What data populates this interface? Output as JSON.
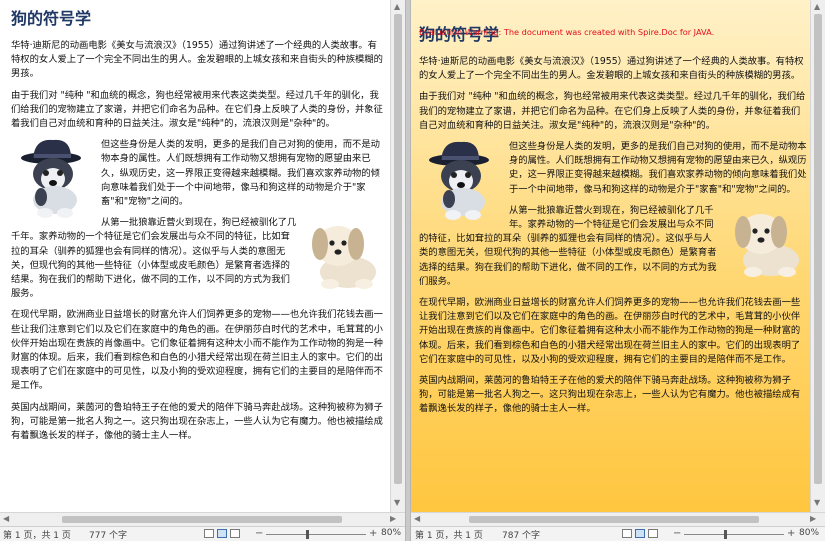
{
  "left_doc": {
    "title": "狗的符号学",
    "paragraphs": [
      "华特·迪斯尼的动画电影《美女与流浪汉》（1955）通过狗讲述了一个经典的人类故事。有特权的女人爱上了一个完全不同出生的男人。金发碧眼的上城女孩和来自街头的种族模糊的男孩。",
      "由于我们对 \"纯种 \"和血统的概念，狗也经常被用来代表这类类型。经过几千年的驯化，我们给我们的宠物建立了家谱，并把它们命名为品种。在它们身上反映了人类的身份，并象征着我们自己对血统和育种的日益关注。淑女是\"纯种\"的，流浪汉则是\"杂种\"的。",
      "但这些身份是人类的发明，更多的是我们自己对狗的使用，而不是动物本身的属性。人们既想拥有工作动物又想拥有宠物的愿望由来已久，纵观历史，这一界限正变得越来越模糊。我们喜欢家养动物的倾向意味着我们处于一个中间地带，像马和狗这样的动物是介于\"家畜\"和\"宠物\"之间的。",
      "从第一批狼靠近营火到现在，狗已经被驯化了几千年。家养动物的一个特征是它们会发展出与众不同的特征，比如耷拉的耳朵（驯养的狐狸也会有同样的情况）。这似乎与人类的意图无关，但现代狗的其他一些特征（小体型或皮毛颜色）是繁育者选择的结果。狗在我们的帮助下进化，做不同的工作，以不同的方式为我们服务。",
      "在现代早期，欧洲商业日益增长的财富允许人们饲养更多的宠物——也允许我们花钱去画一些让我们注意到它们以及它们在家庭中的角色的画。在伊丽莎白时代的艺术中，毛茸茸的小伙伴开始出现在贵族的肖像画中。它们象征着拥有这种太小而不能作为工作动物的狗是一种财富的体现。后来，我们看到棕色和白色的小猎犬经常出现在荷兰旧主人的家中。它们的出现表明了它们在家庭中的可见性，以及小狗的受欢迎程度，拥有它们的主要目的是陪伴而不是工作。",
      "英国内战期间，莱茵河的鲁珀特王子在他的爱犬的陪伴下骑马奔赴战场。这种狗被称为狮子狗，可能是第一批名人狗之一。这只狗出现在杂志上，一些人认为它有魔力。他也被描绘成有着飘逸长发的样子，像他的骑士主人一样。"
    ],
    "status": {
      "page": "第 1 页，共 1 页",
      "words": "777 个字",
      "zoom": "80%"
    }
  },
  "right_doc": {
    "warning": "Evaluation Warning: The document was created with Spire.Doc for JAVA.",
    "title": "狗的符号学",
    "paragraphs": [
      "华特·迪斯尼的动画电影《美女与流浪汉》（1955）通过狗讲述了一个经典的人类故事。有特权的女人爱上了一个完全不同出生的男人。金发碧眼的上城女孩和来自街头的种族模糊的男孩。",
      "由于我们对 \"纯种 \"和血统的概念，狗也经常被用来代表这类类型。经过几千年的驯化，我们给我们的宠物建立了家谱，并把它们命名为品种。在它们身上反映了人类的身份，并象征着我们自己对血统和育种的日益关注。淑女是\"纯种\"的，流浪汉则是\"杂种\"的。",
      "但这些身份是人类的发明，更多的是我们自己对狗的使用，而不是动物本身的属性。人们既想拥有工作动物又想拥有宠物的愿望由来已久，纵观历史，这一界限正变得越来越模糊。我们喜欢家养动物的倾向意味着我们处于一个中间地带，像马和狗这样的动物是介于\"家畜\"和\"宠物\"之间的。",
      "从第一批狼靠近营火到现在，狗已经被驯化了几千年。家养动物的一个特征是它们会发展出与众不同的特征，比如耷拉的耳朵（驯养的狐狸也会有同样的情况）。这似乎与人类的意图无关，但现代狗的其他一些特征（小体型或皮毛颜色）是繁育者选择的结果。狗在我们的帮助下进化，做不同的工作，以不同的方式为我们服务。",
      "在现代早期，欧洲商业日益增长的财富允许人们饲养更多的宠物——也允许我们花钱去画一些让我们注意到它们以及它们在家庭中的角色的画。在伊丽莎白时代的艺术中，毛茸茸的小伙伴开始出现在贵族的肖像画中。它们象征着拥有这种太小而不能作为工作动物的狗是一种财富的体现。后来，我们看到棕色和白色的小猎犬经常出现在荷兰旧主人的家中。它们的出现表明了它们在家庭中的可见性，以及小狗的受欢迎程度，拥有它们的主要目的是陪伴而不是工作。",
      "英国内战期间，莱茵河的鲁珀特王子在他的爱犬的陪伴下骑马奔赴战场。这种狗被称为狮子狗，可能是第一批名人狗之一。这只狗出现在杂志上，一些人认为它有魔力。他也被描绘成有着飘逸长发的样子，像他的骑士主人一样。"
    ],
    "status": {
      "page": "第 1 页，共 1 页",
      "words": "787 个字",
      "zoom": "80%"
    }
  },
  "colors": {
    "title": "#1f3864",
    "warning": "#e0101d",
    "gradient_top": "#fff1c8",
    "gradient_bottom": "#ffc63f"
  },
  "icons": [
    "husky-hat-clipart",
    "puppy-clipart",
    "print-layout-icon",
    "web-layout-icon",
    "read-mode-icon",
    "zoom-out-icon",
    "zoom-in-icon"
  ]
}
